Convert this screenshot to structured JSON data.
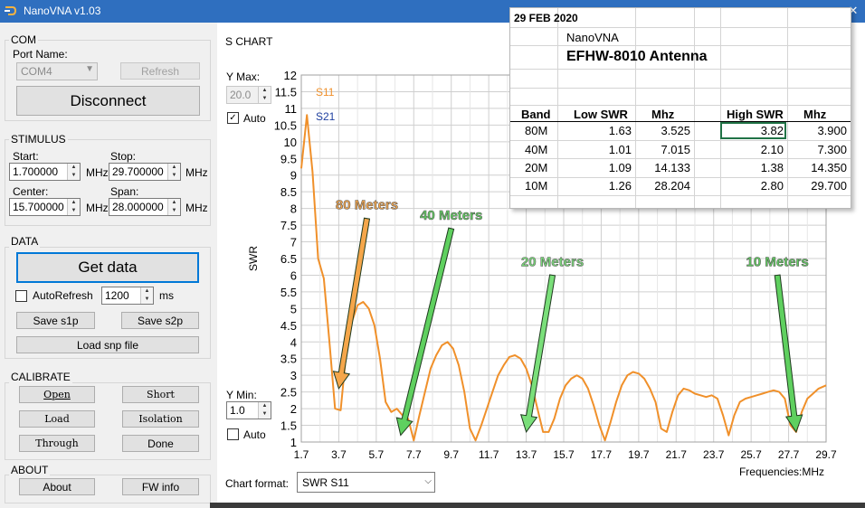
{
  "window": {
    "title": "NanoVNA v1.03",
    "minimize": "—",
    "maximize": "☐",
    "close": "✕"
  },
  "com": {
    "group": "COM",
    "port_label": "Port Name:",
    "port_value": "COM4",
    "refresh": "Refresh",
    "disconnect": "Disconnect"
  },
  "stimulus": {
    "group": "STIMULUS",
    "start_label": "Start:",
    "start_value": "1.700000",
    "stop_label": "Stop:",
    "stop_value": "29.700000",
    "center_label": "Center:",
    "center_value": "15.700000",
    "span_label": "Span:",
    "span_value": "28.000000",
    "unit": "MHz"
  },
  "data_group": {
    "group": "DATA",
    "get_data": "Get data",
    "autorefresh": "AutoRefresh",
    "interval": "1200",
    "ms": "ms",
    "save_s1p": "Save s1p",
    "save_s2p": "Save s2p",
    "load_snp": "Load snp file"
  },
  "calibrate": {
    "group": "CALIBRATE",
    "open": "Open",
    "short": "Short",
    "load": "Load",
    "isolation": "Isolation",
    "through": "Through",
    "done": "Done"
  },
  "about": {
    "group": "ABOUT",
    "about": "About",
    "fw_info": "FW info"
  },
  "schart": {
    "group": "S CHART",
    "ymax_label": "Y Max:",
    "ymax_value": "20.0",
    "auto_label": "Auto",
    "auto_top_checked": "✓",
    "ymin_label": "Y Min:",
    "ymin_value": "1.0",
    "chart_format_label": "Chart format:",
    "chart_format_value": "SWR S11"
  },
  "chart_data": {
    "type": "line",
    "ylabel": "SWR",
    "xlabel": "Frequencies:MHz",
    "ylim": [
      1,
      12
    ],
    "xlim": [
      1.7,
      29.7
    ],
    "grid": true,
    "yticks": [
      "1",
      "1.5",
      "2",
      "2.5",
      "3",
      "3.5",
      "4",
      "4.5",
      "5",
      "5.5",
      "6",
      "6.5",
      "7",
      "7.5",
      "8",
      "8.5",
      "9",
      "9.5",
      "10",
      "10.5",
      "11",
      "11.5",
      "12"
    ],
    "xticks": [
      "1.7",
      "3.7",
      "5.7",
      "7.7",
      "9.7",
      "11.7",
      "13.7",
      "15.7",
      "17.7",
      "19.7",
      "21.7",
      "23.7",
      "25.7",
      "27.7",
      "29.7"
    ],
    "legend": [
      {
        "name": "S11",
        "color": "#f0902a"
      },
      {
        "name": "S21",
        "color": "#2040a0"
      }
    ],
    "series": [
      {
        "name": "S11",
        "color": "#f0902a",
        "x": [
          1.7,
          2.0,
          2.3,
          2.6,
          2.9,
          3.2,
          3.5,
          3.8,
          4.1,
          4.4,
          4.7,
          5.0,
          5.3,
          5.6,
          5.9,
          6.2,
          6.5,
          6.8,
          7.1,
          7.4,
          7.7,
          8.0,
          8.3,
          8.6,
          8.9,
          9.2,
          9.5,
          9.8,
          10.1,
          10.4,
          10.7,
          11.0,
          11.3,
          11.6,
          11.9,
          12.2,
          12.5,
          12.8,
          13.1,
          13.4,
          13.7,
          14.0,
          14.3,
          14.6,
          14.9,
          15.2,
          15.5,
          15.8,
          16.1,
          16.4,
          16.7,
          17.0,
          17.3,
          17.6,
          17.9,
          18.2,
          18.5,
          18.8,
          19.1,
          19.4,
          19.7,
          20.0,
          20.3,
          20.6,
          20.9,
          21.2,
          21.5,
          21.8,
          22.1,
          22.4,
          22.7,
          23.0,
          23.3,
          23.6,
          23.9,
          24.2,
          24.5,
          24.8,
          25.1,
          25.4,
          25.7,
          26.0,
          26.3,
          26.6,
          26.9,
          27.2,
          27.5,
          27.8,
          28.1,
          28.4,
          28.7,
          29.0,
          29.3,
          29.7
        ],
        "y": [
          9.2,
          10.8,
          9.1,
          6.5,
          5.9,
          4.0,
          2.0,
          1.95,
          3.7,
          4.6,
          5.1,
          5.2,
          5.0,
          4.5,
          3.5,
          2.2,
          1.9,
          2.0,
          1.8,
          1.7,
          1.05,
          1.8,
          2.5,
          3.2,
          3.6,
          3.9,
          4.0,
          3.8,
          3.3,
          2.5,
          1.4,
          1.05,
          1.5,
          2.0,
          2.5,
          3.0,
          3.3,
          3.55,
          3.6,
          3.5,
          3.2,
          2.7,
          2.0,
          1.3,
          1.3,
          1.7,
          2.3,
          2.7,
          2.9,
          3.0,
          2.9,
          2.6,
          2.1,
          1.5,
          1.05,
          1.6,
          2.2,
          2.7,
          3.0,
          3.1,
          3.05,
          2.9,
          2.6,
          2.2,
          1.4,
          1.3,
          1.9,
          2.4,
          2.6,
          2.55,
          2.45,
          2.4,
          2.35,
          2.4,
          2.3,
          1.8,
          1.2,
          1.8,
          2.2,
          2.3,
          2.35,
          2.4,
          2.45,
          2.5,
          2.55,
          2.5,
          2.3,
          1.5,
          1.3,
          1.9,
          2.3,
          2.45,
          2.6,
          2.7
        ]
      }
    ],
    "annotations": [
      {
        "text": "80 Meters",
        "color": "#f5a64a",
        "from": [
          5.2,
          7.7
        ],
        "to": [
          3.7,
          2.6
        ]
      },
      {
        "text": "40 Meters",
        "color": "#5fd05f",
        "from": [
          9.7,
          7.4
        ],
        "to": [
          7.0,
          1.2
        ]
      },
      {
        "text": "20 Meters",
        "color": "#7adf7a",
        "from": [
          15.1,
          6.0
        ],
        "to": [
          13.7,
          1.3
        ]
      },
      {
        "text": "10 Meters",
        "color": "#5fd05f",
        "from": [
          27.1,
          6.0
        ],
        "to": [
          28.1,
          1.3
        ]
      }
    ]
  },
  "sheet": {
    "date": "29 FEB 2020",
    "brand": "NanoVNA",
    "title": "EFHW-8010 Antenna",
    "headers": {
      "band": "Band",
      "low": "Low SWR",
      "mhz1": "Mhz",
      "high": "High SWR",
      "mhz2": "Mhz"
    },
    "rows": [
      {
        "band": "80M",
        "low": "1.63",
        "mhz1": "3.525",
        "high": "3.82",
        "mhz2": "3.900"
      },
      {
        "band": "40M",
        "low": "1.01",
        "mhz1": "7.015",
        "high": "2.10",
        "mhz2": "7.300"
      },
      {
        "band": "20M",
        "low": "1.09",
        "mhz1": "14.133",
        "high": "1.38",
        "mhz2": "14.350"
      },
      {
        "band": "10M",
        "low": "1.26",
        "mhz1": "28.204",
        "high": "2.80",
        "mhz2": "29.700"
      }
    ]
  }
}
